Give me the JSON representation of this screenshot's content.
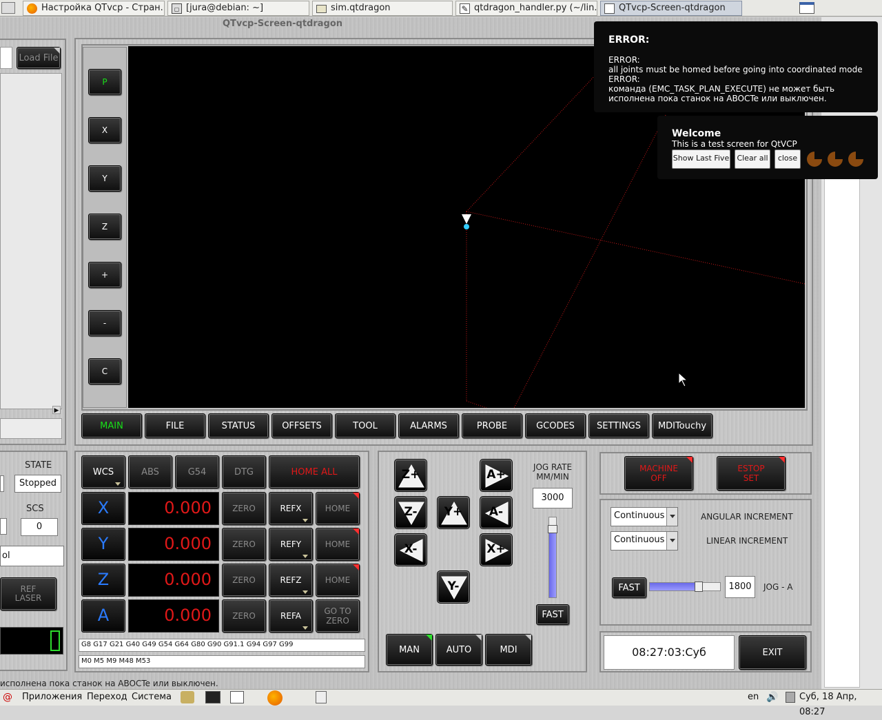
{
  "taskbar_top": {
    "tabs": [
      {
        "label": "Настройка QTvcp - Стран...",
        "icon": "firefox-icon"
      },
      {
        "label": "[jura@debian: ~]",
        "icon": "terminal-icon"
      },
      {
        "label": "sim.qtdragon",
        "icon": "folder-icon"
      },
      {
        "label": "qtdragon_handler.py (~/lin...",
        "icon": "text-editor-icon"
      },
      {
        "label": "QTvcp-Screen-qtdragon",
        "icon": "window-icon"
      }
    ]
  },
  "window": {
    "title": "QTvcp-Screen-qtdragon"
  },
  "left": {
    "load_file": "Load File",
    "state_label": "STATE",
    "state_value": "Stopped",
    "scs_label": "SCS",
    "scs_value": "0",
    "tool_partial": "ol",
    "ref_laser": "REF\nLASER"
  },
  "view_buttons": [
    "P",
    "X",
    "Y",
    "Z",
    "+",
    "-",
    "C"
  ],
  "tabs": [
    "MAIN",
    "FILE",
    "STATUS",
    "OFFSETS",
    "TOOL",
    "ALARMS",
    "PROBE",
    "GCODES",
    "SETTINGS",
    "MDITouchy"
  ],
  "dro": {
    "header": {
      "wcs": "WCS",
      "abs": "ABS",
      "g54": "G54",
      "dtg": "DTG",
      "home_all": "HOME ALL"
    },
    "axes": [
      {
        "axis": "X",
        "value": "0.000",
        "zero": "ZERO",
        "ref": "REFX",
        "home": "HOME"
      },
      {
        "axis": "Y",
        "value": "0.000",
        "zero": "ZERO",
        "ref": "REFY",
        "home": "HOME"
      },
      {
        "axis": "Z",
        "value": "0.000",
        "zero": "ZERO",
        "ref": "REFZ",
        "home": "HOME"
      },
      {
        "axis": "A",
        "value": "0.000",
        "zero": "ZERO",
        "ref": "REFA",
        "home": "GO TO\nZERO"
      }
    ],
    "gcodes": "G8 G17 G21 G40 G49 G54 G64 G80 G90 G91.1 G94 G97 G99",
    "mcodes": "M0 M5 M9 M48 M53"
  },
  "jog": {
    "buttons": [
      "Z+",
      "Z-",
      "Y+",
      "A+",
      "A-",
      "X-",
      "X+",
      "Y-"
    ],
    "rate_label": "JOG RATE\nMM/MIN",
    "rate_value": "3000",
    "rate_slider_fraction": 0.85,
    "fast": "FAST",
    "modes": [
      "MAN",
      "AUTO",
      "MDI"
    ]
  },
  "machine": {
    "machine_off": "MACHINE\nOFF",
    "estop": "ESTOP\nSET",
    "angular_combo": "Continuous",
    "angular_label": "ANGULAR INCREMENT",
    "linear_combo": "Continuous",
    "linear_label": "LINEAR INCREMENT",
    "fast": "FAST",
    "jog_a_value": "1800",
    "jog_a_label": "JOG - A",
    "jog_a_slider_fraction": 0.7,
    "clock": "08:27:03:Суб",
    "exit": "EXIT"
  },
  "error_popup": {
    "title": "ERROR:",
    "lines": [
      "ERROR:",
      "all joints must be homed before going into coordinated mode",
      "ERROR:",
      "команда (EMC_TASK_PLAN_EXECUTE) не может быть",
      "исполнена пока станок на ABOCTe или выключен."
    ]
  },
  "welcome_popup": {
    "title": "Welcome",
    "text": "This is a test screen for QtVCP",
    "show_last_five": "Show Last Five",
    "clear_all": "Clear all",
    "close": "close"
  },
  "statusbar": "исполнена пока станок на ABOCTe или выключен.",
  "taskbar_bottom": {
    "apps": "Приложения",
    "places": "Переход",
    "system": "Система",
    "lang": "en",
    "datetime": "Суб, 18 Апр, 08:27"
  },
  "colors": {
    "dro_text": "#e01818",
    "axis_text": "#2a7bff",
    "active_tab": "#18e018",
    "alert_corner": "#ff3030"
  }
}
